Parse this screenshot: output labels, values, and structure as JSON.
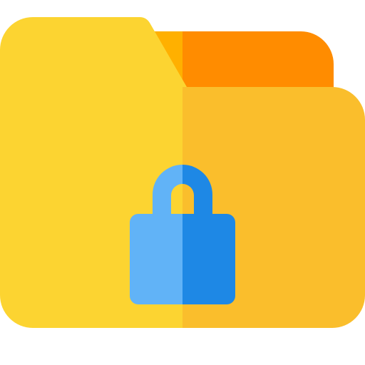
{
  "icon": {
    "name": "locked-folder-icon",
    "description_hidden": "",
    "colors": {
      "background": "#ffffff",
      "folder_back_left": "#FFB000",
      "folder_back_right": "#FF8C00",
      "folder_front_left": "#FCD431",
      "folder_front_right": "#FABE2C",
      "lock_left": "#61B3F7",
      "lock_right": "#1E88E5"
    }
  }
}
